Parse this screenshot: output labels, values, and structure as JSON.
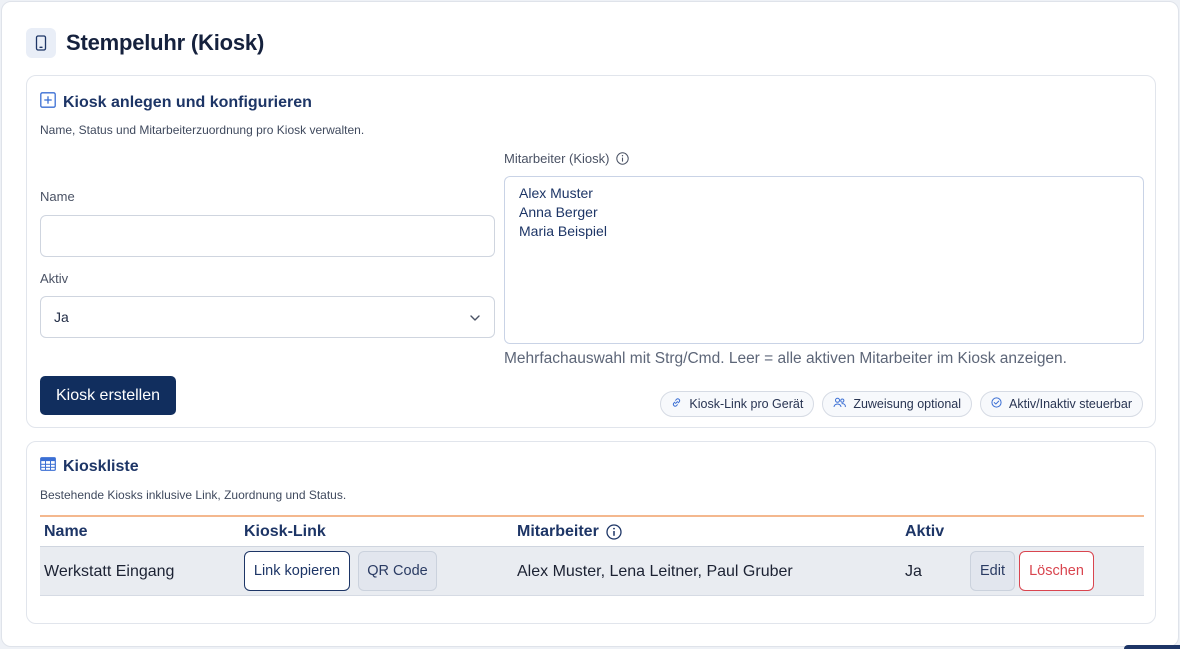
{
  "page": {
    "title": "Stempeluhr (Kiosk)",
    "icon": "tablet-icon"
  },
  "create_card": {
    "title": "Kiosk anlegen und konfigurieren",
    "icon": "plus-square-icon",
    "subtitle": "Name, Status und Mitarbeiterzuordnung pro Kiosk verwalten.",
    "name_label": "Name",
    "name_value": "",
    "active_label": "Aktiv",
    "active_value": "Ja",
    "employees_label": "Mitarbeiter (Kiosk)",
    "employees_options": [
      "Alex Muster",
      "Anna Berger",
      "Maria Beispiel"
    ],
    "hint": "Mehrfachauswahl mit Strg/Cmd. Leer = alle aktiven Mitarbeiter im Kiosk anzeigen.",
    "submit_label": "Kiosk erstellen",
    "chips": [
      {
        "label": "Kiosk-Link pro Gerät",
        "icon": "link-icon"
      },
      {
        "label": "Zuweisung optional",
        "icon": "users-icon"
      },
      {
        "label": "Aktiv/Inaktiv steuerbar",
        "icon": "check-circle-icon"
      }
    ]
  },
  "list_card": {
    "title": "Kioskliste",
    "icon": "table-icon",
    "subtitle": "Bestehende Kiosks inklusive Link, Zuordnung und Status.",
    "columns": [
      "Name",
      "Kiosk-Link",
      "Mitarbeiter",
      "Aktiv"
    ],
    "rows": [
      {
        "name": "Werkstatt Eingang",
        "copy_link_label": "Link kopieren",
        "qr_label": "QR Code",
        "employees": "Alex Muster, Lena Leitner, Paul Gruber",
        "active": "Ja",
        "edit_label": "Edit",
        "delete_label": "Löschen"
      }
    ]
  },
  "colors": {
    "primary": "#112e5e",
    "heading": "#1d3566",
    "danger": "#d9454f",
    "table_accent": "#f4b88e"
  }
}
